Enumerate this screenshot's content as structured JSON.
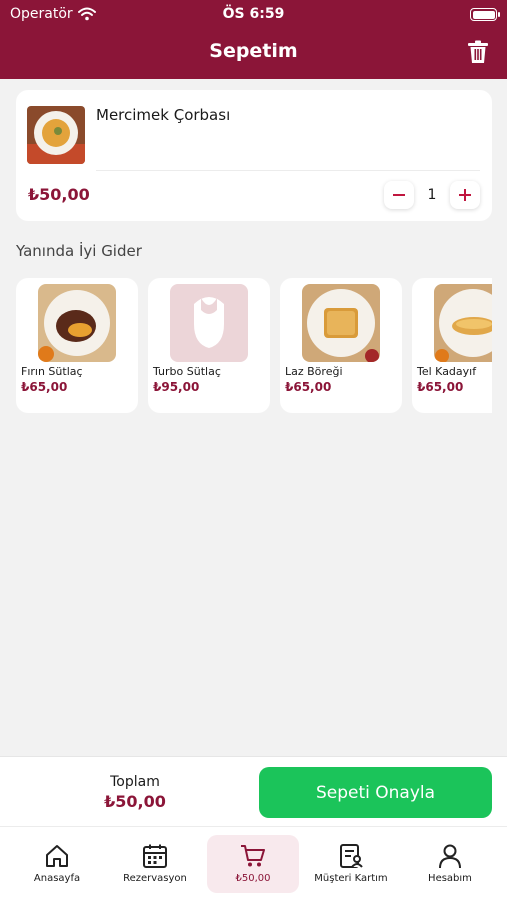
{
  "status_bar": {
    "carrier": "Operatör",
    "time": "ÖS 6:59"
  },
  "header": {
    "title": "Sepetim"
  },
  "cart": {
    "items": [
      {
        "name": "Mercimek Çorbası",
        "price": "₺50,00",
        "quantity": "1"
      }
    ]
  },
  "suggestions": {
    "title": "Yanında İyi Gider",
    "items": [
      {
        "name": "Fırın Sütlaç",
        "price": "₺65,00"
      },
      {
        "name": "Turbo Sütlaç",
        "price": "₺95,00"
      },
      {
        "name": "Laz Böreği",
        "price": "₺65,00"
      },
      {
        "name": "Tel Kadayıf",
        "price": "₺65,00"
      }
    ]
  },
  "checkout": {
    "total_label": "Toplam",
    "total_value": "₺50,00",
    "confirm_label": "Sepeti Onayla"
  },
  "tabbar": {
    "items": [
      {
        "label": "Anasayfa",
        "icon": "home-icon"
      },
      {
        "label": "Rezervasyon",
        "icon": "calendar-icon"
      },
      {
        "label": "₺50,00",
        "icon": "cart-icon"
      },
      {
        "label": "Müşteri Kartım",
        "icon": "customer-card-icon"
      },
      {
        "label": "Hesabım",
        "icon": "user-icon"
      }
    ]
  },
  "colors": {
    "brand": "#8b1538",
    "confirm": "#1bc45a",
    "background": "#f2f2f2"
  }
}
